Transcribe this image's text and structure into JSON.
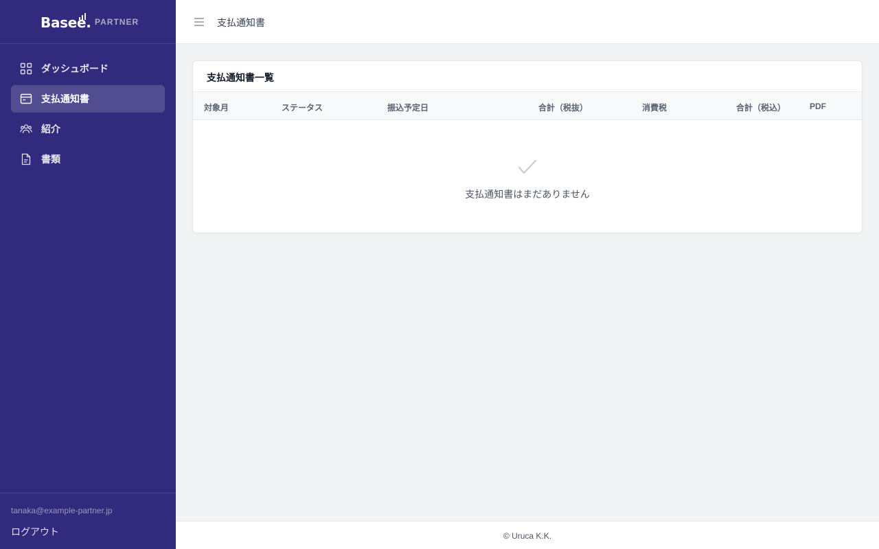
{
  "brand": {
    "logo_text": "Basee.",
    "sub_label": "PARTNER"
  },
  "sidebar": {
    "items": [
      {
        "label": "ダッシュボード",
        "icon": "grid-icon",
        "active": false
      },
      {
        "label": "支払通知書",
        "icon": "card-icon",
        "active": true
      },
      {
        "label": "紹介",
        "icon": "users-icon",
        "active": false
      },
      {
        "label": "書類",
        "icon": "document-icon",
        "active": false
      }
    ],
    "user_email": "tanaka@example-partner.jp",
    "logout_label": "ログアウト"
  },
  "header": {
    "menu_icon": "hamburger-icon",
    "title": "支払通知書"
  },
  "main": {
    "card_title": "支払通知書一覧",
    "columns": [
      "対象月",
      "ステータス",
      "振込予定日",
      "合計（税抜）",
      "消費税",
      "合計（税込）",
      "PDF"
    ],
    "rows": [],
    "empty_icon": "check-icon",
    "empty_message": "支払通知書はまだありません"
  },
  "footer": {
    "copyright": "© Uruca K.K."
  },
  "colors": {
    "sidebar_bg": "#322a7d",
    "page_bg": "#f2f3f5",
    "active_item_bg": "rgba(255,255,255,0.16)"
  }
}
